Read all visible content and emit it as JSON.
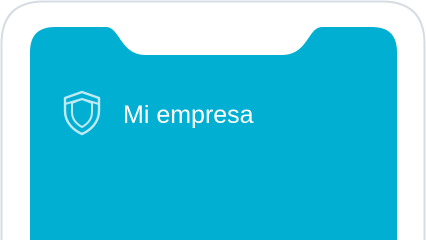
{
  "app": {
    "title": "Mi empresa",
    "icon": "shield-icon"
  },
  "colors": {
    "screen_background": "#00afd2",
    "frame_stroke": "#d6dde2",
    "icon_stroke": "#bfe9f3",
    "title_text": "#ffffff"
  }
}
